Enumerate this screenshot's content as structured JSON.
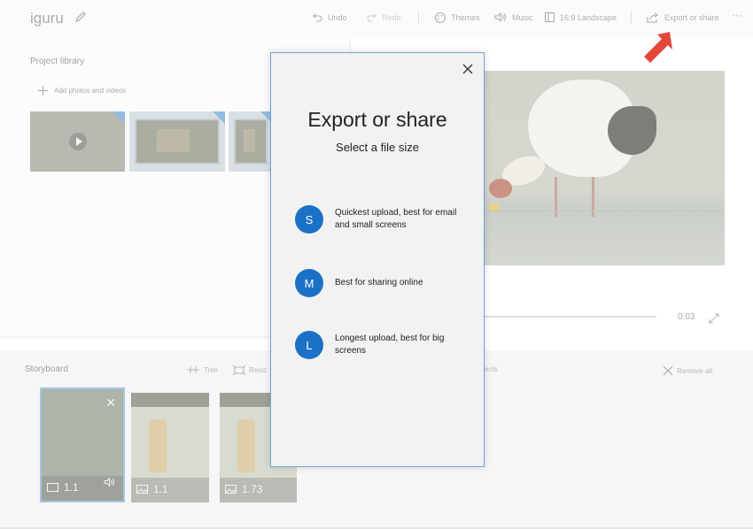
{
  "app": {
    "title": "iguru"
  },
  "toolbar": {
    "undo": "Undo",
    "redo": "Redo",
    "themes": "Themes",
    "music": "Music",
    "aspect": "16:9 Landscape",
    "export": "Export or share",
    "more": "···"
  },
  "library": {
    "title": "Project library",
    "add": "Add photos and videos"
  },
  "preview": {
    "time": "0:03"
  },
  "storyboard": {
    "title": "Storyboard",
    "tools": {
      "trim": "Trim",
      "resize": "Resiz",
      "effects": "ects",
      "remove_all": "Remove all"
    },
    "cards": [
      {
        "duration": "1.1"
      },
      {
        "duration": "1.1"
      },
      {
        "duration": "1.73"
      }
    ]
  },
  "dialog": {
    "title": "Export or share",
    "subtitle": "Select a file size",
    "options": [
      {
        "letter": "S",
        "text": "Quickest upload, best for email and small screens"
      },
      {
        "letter": "M",
        "text": "Best for sharing online"
      },
      {
        "letter": "L",
        "text": "Longest upload, best for big screens"
      }
    ]
  },
  "colors": {
    "accent": "#1b71c5",
    "arrow": "#e2473a",
    "dialog_border": "#6fa5d6"
  }
}
